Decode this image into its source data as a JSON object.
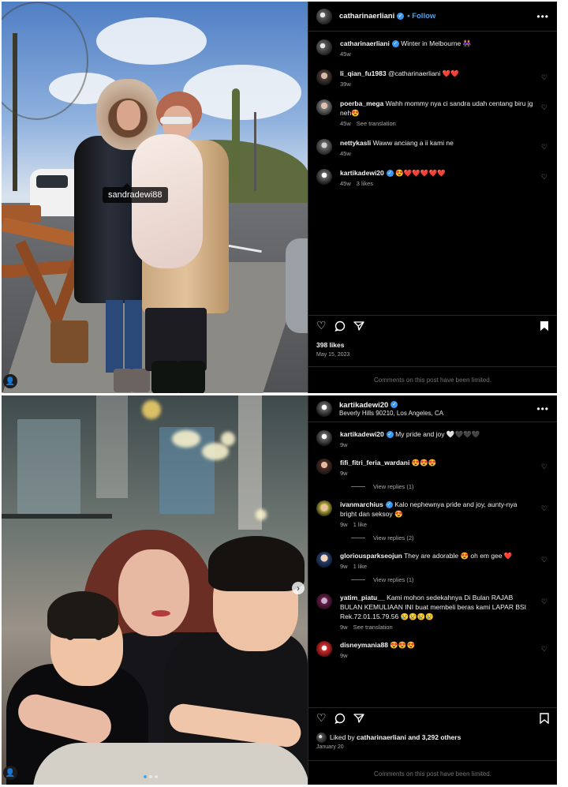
{
  "post1": {
    "author": "catharinaerliani",
    "follow_label": "Follow",
    "more_label": "•••",
    "photo_tag": "sandradewi88",
    "user_badge": "👤",
    "comments": [
      {
        "user": "catharinaerliani",
        "text": "Winter in Melbourne 👭",
        "meta": [
          "45w"
        ],
        "verified": true,
        "heart": false
      },
      {
        "user": "li_qian_fu1983",
        "text": "@catharinaerliani ❤️❤️",
        "meta": [
          "39w"
        ],
        "verified": false,
        "heart": true
      },
      {
        "user": "poerba_mega",
        "text": "Wahh mommy nya ci sandra udah centang biru jg neh😍",
        "meta": [
          "45w",
          "See translation"
        ],
        "verified": false,
        "heart": true
      },
      {
        "user": "nettykasli",
        "text": "Waww anciang a ii kami ne",
        "meta": [
          "45w"
        ],
        "verified": false,
        "heart": true
      },
      {
        "user": "kartikadewi20",
        "text": "😍❤️❤️❤️❤️❤️",
        "meta": [
          "45w",
          "3 likes"
        ],
        "verified": true,
        "heart": true
      }
    ],
    "likes": "398 likes",
    "date": "May 15, 2023",
    "limited": "Comments on this post have been limited."
  },
  "post2": {
    "author": "kartikadewi20",
    "location": "Beverly Hills 90210, Los Angeles, CA",
    "more_label": "•••",
    "comments": [
      {
        "user": "kartikadewi20",
        "text": "My pride and joy 🤍🖤🖤🖤",
        "meta": [
          "9w"
        ],
        "verified": true,
        "heart": false,
        "replies": ""
      },
      {
        "user": "fifi_fitri_feria_wardani",
        "text": "😍😍😍",
        "meta": [
          "9w"
        ],
        "verified": false,
        "heart": true,
        "replies": "View replies (1)"
      },
      {
        "user": "ivanmarchius",
        "text": "Kalo nephewnya pride and joy, aunty-nya bright dan seksoy 😍",
        "meta": [
          "9w",
          "1 like"
        ],
        "verified": true,
        "heart": true,
        "replies": "View replies (2)"
      },
      {
        "user": "gloriousparkseojun",
        "text": "They are adorable 😍 oh em gee ❤️",
        "meta": [
          "9w",
          "1 like"
        ],
        "verified": false,
        "heart": true,
        "replies": "View replies (1)"
      },
      {
        "user": "yatim_piatu__",
        "text": "Kami mohon sedekahnya Di Bulan RAJAB BULAN KEMULIAAN INI buat membeli beras kami LAPAR BSI Rek.72.01.15.79.56 😢😢😢😢",
        "meta": [
          "9w",
          "See translation"
        ],
        "verified": false,
        "heart": true,
        "replies": ""
      },
      {
        "user": "disneymania88",
        "text": "😍😍😍",
        "meta": [
          "9w"
        ],
        "verified": false,
        "heart": true,
        "replies": ""
      }
    ],
    "liked_by_prefix": "Liked by ",
    "liked_by_user": "catharinaerliani",
    "liked_by_suffix": " and 3,292 others",
    "date": "January 20",
    "limited": "Comments on this post have been limited."
  },
  "colors": {
    "accent": "#4aa3f0",
    "verified": "#3897f0",
    "bg": "#000000",
    "muted": "#a8a8a8"
  }
}
